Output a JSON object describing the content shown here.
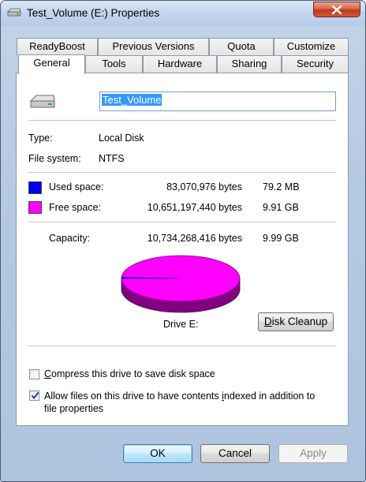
{
  "window": {
    "title": "Test_Volume (E:) Properties"
  },
  "tabs": {
    "top_row": [
      "ReadyBoost",
      "Previous Versions",
      "Quota",
      "Customize"
    ],
    "bottom_row": [
      "General",
      "Tools",
      "Hardware",
      "Sharing",
      "Security"
    ],
    "active": "General"
  },
  "general": {
    "volume_name": "Test_Volume",
    "type_label": "Type:",
    "type_value": "Local Disk",
    "fs_label": "File system:",
    "fs_value": "NTFS",
    "used_label": "Used space:",
    "used_bytes": "83,070,976 bytes",
    "used_size": "79.2 MB",
    "free_label": "Free space:",
    "free_bytes": "10,651,197,440 bytes",
    "free_size": "9.91 GB",
    "capacity_label": "Capacity:",
    "capacity_bytes": "10,734,268,416 bytes",
    "capacity_size": "9.99 GB",
    "drive_label": "Drive E:",
    "disk_cleanup_pre": "",
    "disk_cleanup_key": "D",
    "disk_cleanup_post": "isk Cleanup",
    "compress_pre": "",
    "compress_key": "C",
    "compress_post": "ompress this drive to save disk space",
    "compress_checked": false,
    "index_pre": "Allow files on this drive to have contents ",
    "index_key": "i",
    "index_post": "ndexed in addition to file properties",
    "index_checked": true
  },
  "colors": {
    "used": "#0000ee",
    "free": "#ff00ff"
  },
  "usage_fraction": {
    "used": 0.0077,
    "free": 0.9923
  },
  "buttons": {
    "ok": "OK",
    "cancel": "Cancel",
    "apply": "Apply"
  }
}
